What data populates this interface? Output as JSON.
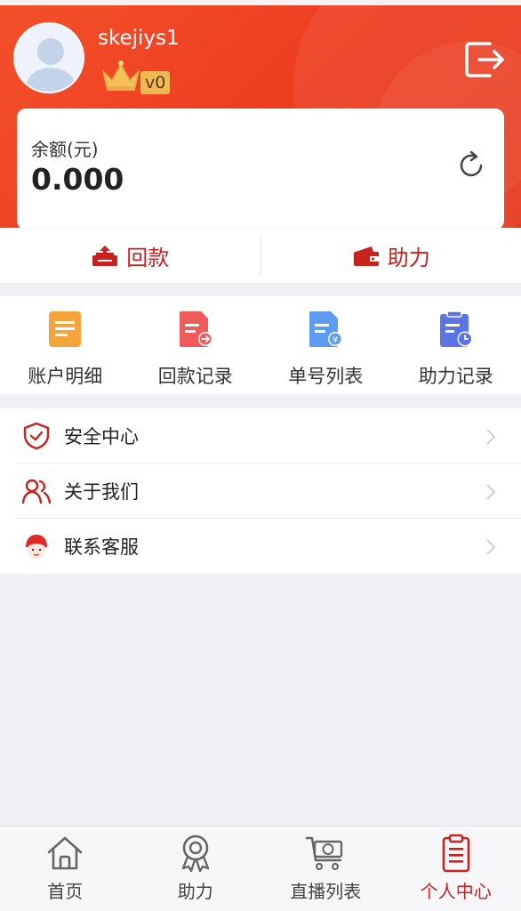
{
  "user": {
    "username": "skejiys1",
    "vip_level": "v0"
  },
  "balance": {
    "label": "余额(元)",
    "value": "0.000"
  },
  "actions": [
    {
      "label": "回款",
      "icon": "repayment-icon"
    },
    {
      "label": "助力",
      "icon": "wallet-icon"
    }
  ],
  "quick_links": [
    {
      "label": "账户明细",
      "icon": "account-detail-icon",
      "color": "#f5a43c"
    },
    {
      "label": "回款记录",
      "icon": "repayment-record-icon",
      "color": "#ef5a5a"
    },
    {
      "label": "单号列表",
      "icon": "order-list-icon",
      "color": "#5d9cf0"
    },
    {
      "label": "助力记录",
      "icon": "support-record-icon",
      "color": "#5b74e6"
    }
  ],
  "menu": [
    {
      "label": "安全中心",
      "icon": "shield-icon"
    },
    {
      "label": "关于我们",
      "icon": "users-icon"
    },
    {
      "label": "联系客服",
      "icon": "customer-service-icon"
    }
  ],
  "tabs": [
    {
      "label": "首页",
      "icon": "home-icon",
      "active": false
    },
    {
      "label": "助力",
      "icon": "medal-icon",
      "active": false
    },
    {
      "label": "直播列表",
      "icon": "cart-icon",
      "active": false
    },
    {
      "label": "个人中心",
      "icon": "clipboard-icon",
      "active": true
    }
  ],
  "colors": {
    "brand_red": "#c8211e",
    "header_orange": "#ef4423"
  }
}
